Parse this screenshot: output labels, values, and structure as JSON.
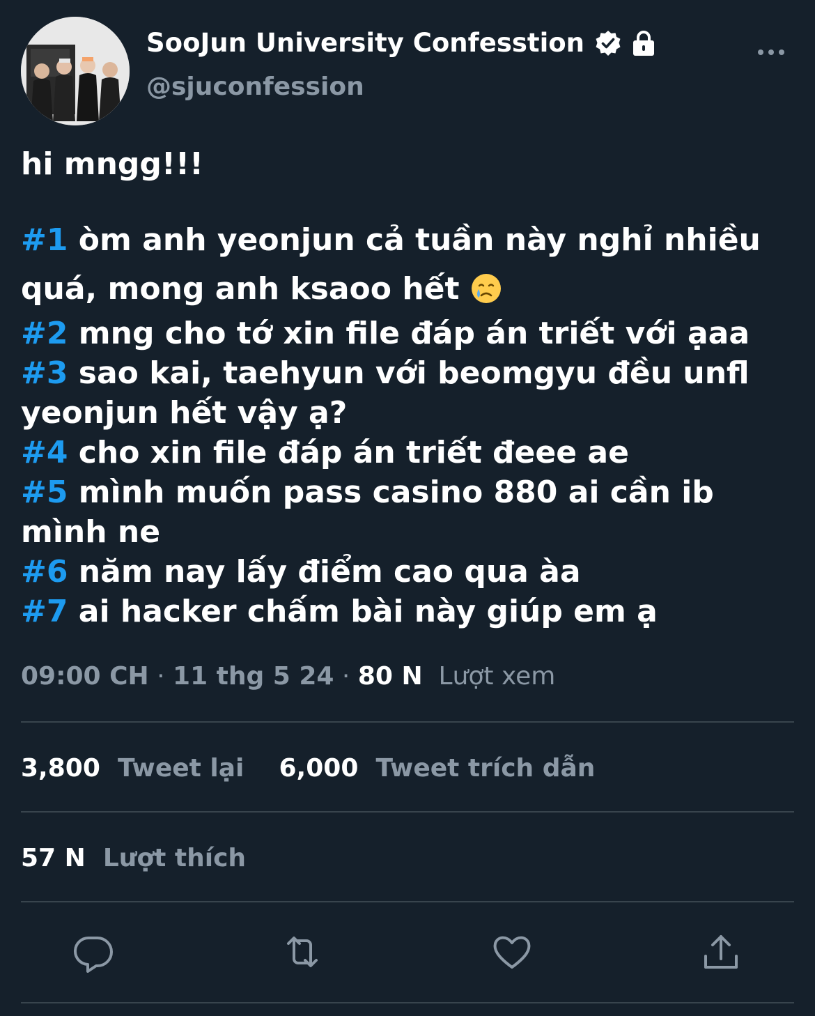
{
  "author": {
    "display_name": "SooJun University Confesstion",
    "handle": "@sjuconfession"
  },
  "tweet": {
    "lines": [
      {
        "text": "hi mngg!!!"
      },
      {
        "text": ""
      },
      {
        "tag": "#1",
        "text": " òm anh yeonjun cả tuần này nghỉ nhiều"
      },
      {
        "text": "quá, mong anh ksaoo hết "
      },
      {
        "tag": "#2",
        "text": " mng cho tớ xin file đáp án triết với ạaa"
      },
      {
        "tag": "#3",
        "text": " sao kai, taehyun với beomgyu đều unfl"
      },
      {
        "text": "yeonjun hết vậy ạ?"
      },
      {
        "tag": "#4",
        "text": " cho xin file đáp án triết đeee ae"
      },
      {
        "tag": "#5",
        "text": " mình muốn pass casino 880 ai cần ib"
      },
      {
        "text": "mình ne"
      },
      {
        "tag": "#6",
        "text": " năm nay lấy điểm cao qua àa"
      },
      {
        "tag": "#7",
        "text": " ai hacker chấm bài này giúp em ạ"
      }
    ],
    "emoji": "crying-face"
  },
  "meta": {
    "time": "09:00 CH",
    "separator": " · ",
    "date": "11 thg 5 24",
    "views_count": "80 N",
    "views_label": "Lượt xem"
  },
  "stats": {
    "retweets_count": "3,800",
    "retweets_label": "Tweet lại",
    "quotes_count": "6,000",
    "quotes_label": "Tweet trích dẫn",
    "likes_count": "57 N",
    "likes_label": "Lượt thích"
  },
  "actions": [
    "reply-icon",
    "retweet-icon",
    "like-icon",
    "share-icon"
  ],
  "colors": {
    "background": "#15202b",
    "text": "#ffffff",
    "secondary": "#8b98a5",
    "hashtag": "#1d9bf0",
    "divider": "#38444d"
  }
}
